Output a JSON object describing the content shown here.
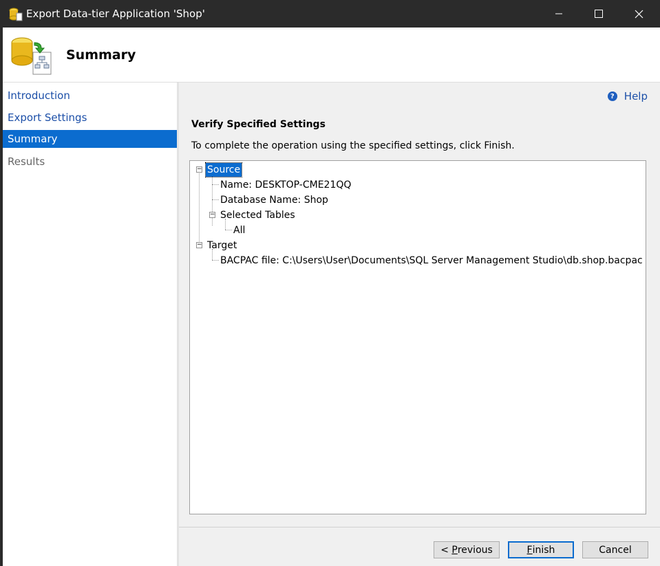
{
  "window": {
    "title": "Export Data-tier Application 'Shop'",
    "controls": {
      "minimize": "—",
      "maximize": "☐",
      "close": "✕"
    }
  },
  "header": {
    "title": "Summary"
  },
  "sidebar": {
    "items": [
      {
        "label": "Introduction",
        "state": "link"
      },
      {
        "label": "Export Settings",
        "state": "link"
      },
      {
        "label": "Summary",
        "state": "active"
      },
      {
        "label": "Results",
        "state": "disabled"
      }
    ]
  },
  "main": {
    "help_label": "Help",
    "section_title": "Verify Specified Settings",
    "instruction": "To complete the operation using the specified settings, click Finish.",
    "tree": {
      "source": "Source",
      "name": "Name: DESKTOP-CME21QQ",
      "database": "Database Name: Shop",
      "selected_tables": "Selected Tables",
      "all": "All",
      "target": "Target",
      "bacpac": "BACPAC file: C:\\Users\\User\\Documents\\SQL Server Management Studio\\db.shop.bacpac"
    }
  },
  "buttons": {
    "previous_prefix": "< ",
    "previous_hotkey": "P",
    "previous_rest": "revious",
    "finish_hotkey": "F",
    "finish_rest": "inish",
    "cancel": "Cancel"
  },
  "colors": {
    "accent": "#0b6ccf",
    "link": "#1c4fa8",
    "titlebar": "#2b2b2b"
  }
}
